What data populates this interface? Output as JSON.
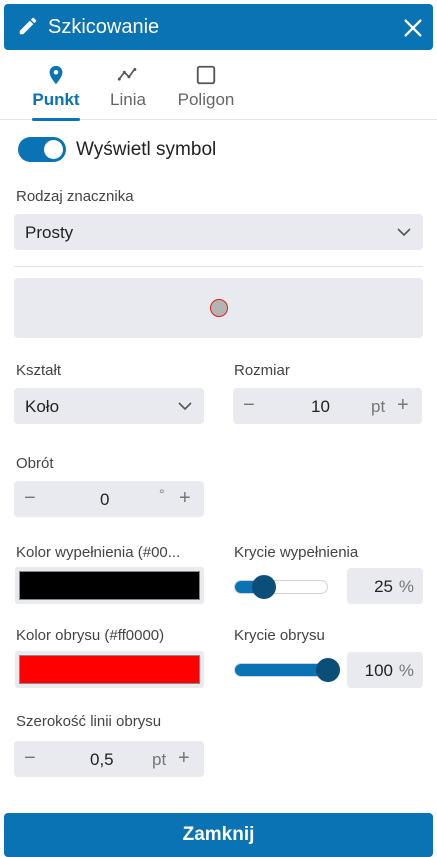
{
  "header": {
    "title": "Szkicowanie",
    "icon": "pencil-icon",
    "close_icon": "close-icon"
  },
  "tabs": [
    {
      "label": "Punkt",
      "icon": "map-pin-icon",
      "active": true
    },
    {
      "label": "Linia",
      "icon": "polyline-icon",
      "active": false
    },
    {
      "label": "Poligon",
      "icon": "square-icon",
      "active": false
    }
  ],
  "display_symbol": {
    "label": "Wyświetl symbol",
    "on": true
  },
  "marker_type": {
    "label": "Rodzaj znacznika",
    "value": "Prosty"
  },
  "shape": {
    "label": "Kształt",
    "value": "Koło"
  },
  "size": {
    "label": "Rozmiar",
    "value": "10",
    "unit": "pt"
  },
  "rotation": {
    "label": "Obrót",
    "value": "0",
    "unit": "°"
  },
  "fill_color": {
    "label": "Kolor wypełnienia (#00...",
    "color": "#000000"
  },
  "fill_opacity": {
    "label": "Krycie wypełnienia",
    "value": "25",
    "unit": "%",
    "level": 0.25
  },
  "stroke_color": {
    "label": "Kolor obrysu (#ff0000)",
    "color": "#ff0000"
  },
  "stroke_opacity": {
    "label": "Krycie obrysu",
    "value": "100",
    "unit": "%",
    "level": 1.0
  },
  "stroke_width": {
    "label": "Szerokość linii obrysu",
    "value": "0,5",
    "unit": "pt"
  },
  "stepper_minus": "−",
  "stepper_plus": "+",
  "close_button": "Zamknij",
  "colors": {
    "accent": "#0a73b3",
    "thumb": "#0b4e77",
    "field_bg": "#e8eaef"
  }
}
